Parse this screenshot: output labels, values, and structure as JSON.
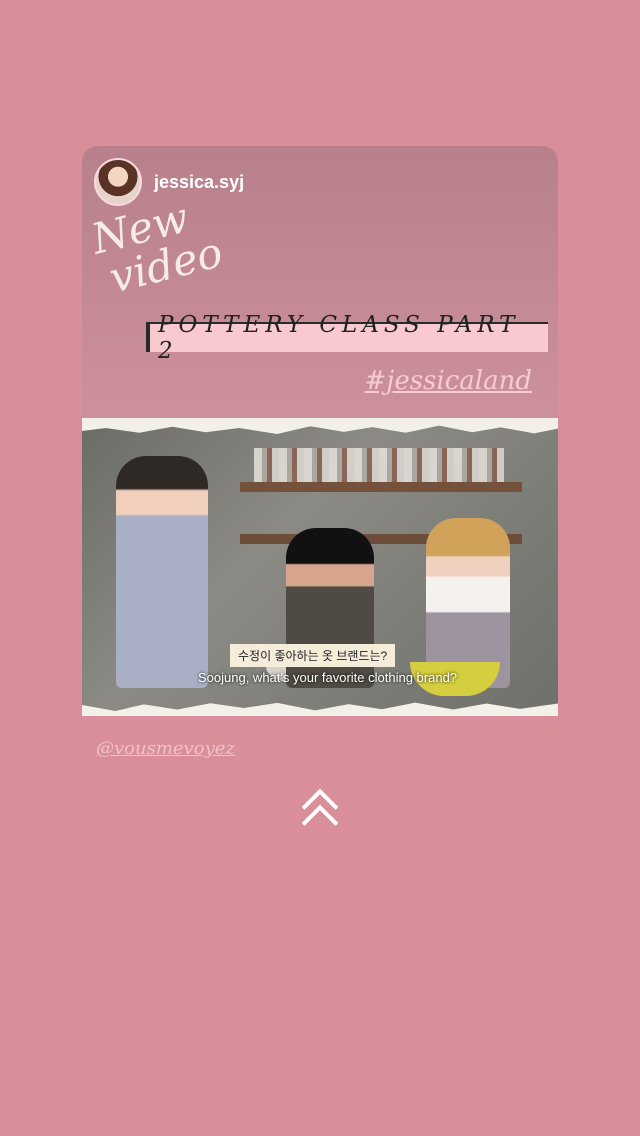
{
  "story": {
    "username": "jessica.syj",
    "new_video_line1": "New",
    "new_video_line2": "video",
    "title": "POTTERY CLASS PART 2",
    "hashtag": "#jessicaland",
    "subtitle_ko": "수정이 좋아하는 옷 브랜드는?",
    "subtitle_en": "Soojung, what's your favorite clothing brand?",
    "mention": "@vousmevoyez"
  },
  "icons": {
    "swipe_up": "double-chevron-up-icon"
  }
}
